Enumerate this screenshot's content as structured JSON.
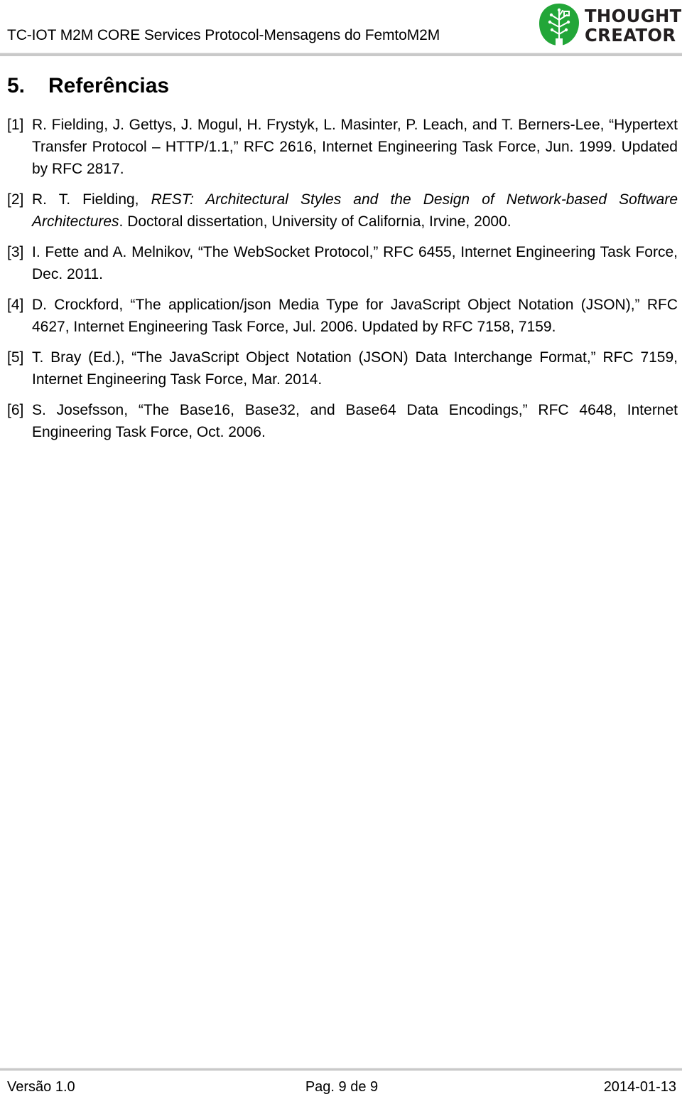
{
  "header": {
    "document_title": "TC-IOT M2M CORE Services Protocol-Mensagens do FemtoM2M",
    "logo": {
      "name": "thought-creator-logo",
      "line1": "THOUGHT",
      "line2": "CREATOR",
      "mark_color": "#22a638",
      "text_color": "#231f20"
    },
    "rule_color": "#c9c9c9"
  },
  "section": {
    "number": "5.",
    "title": "Referências"
  },
  "references": [
    {
      "marker": "[1]",
      "parts": [
        {
          "style": "normal",
          "text": "R. Fielding, J. Gettys, J. Mogul, H. Frystyk, L. Masinter, P. Leach, and T. Berners-Lee, “Hypertext Transfer Protocol – HTTP/1.1,” RFC 2616, Internet Engineering Task Force, Jun. 1999. Updated by RFC 2817."
        }
      ]
    },
    {
      "marker": "[2]",
      "parts": [
        {
          "style": "normal",
          "text": "R. T. Fielding, "
        },
        {
          "style": "italic",
          "text": "REST: Architectural Styles and the Design of Network-based Software Architectures"
        },
        {
          "style": "normal",
          "text": ". Doctoral dissertation, University of California, Irvine, 2000."
        }
      ]
    },
    {
      "marker": "[3]",
      "parts": [
        {
          "style": "normal",
          "text": "I. Fette and A. Melnikov, “The WebSocket Protocol,” RFC 6455, Internet Engineering Task Force, Dec. 2011."
        }
      ]
    },
    {
      "marker": "[4]",
      "parts": [
        {
          "style": "normal",
          "text": "D. Crockford, “The application/json Media Type for JavaScript Object Notation (JSON),” RFC 4627, Internet Engineering Task Force, Jul. 2006. Updated by RFC 7158, 7159."
        }
      ]
    },
    {
      "marker": "[5]",
      "parts": [
        {
          "style": "normal",
          "text": "T. Bray (Ed.), “The JavaScript Object Notation (JSON) Data Interchange Format,” RFC 7159, Internet Engineering Task Force, Mar. 2014."
        }
      ]
    },
    {
      "marker": "[6]",
      "parts": [
        {
          "style": "normal",
          "text": "S. Josefsson, “The Base16, Base32, and Base64 Data Encodings,” RFC 4648, Internet Engineering Task Force, Oct. 2006."
        }
      ]
    }
  ],
  "footer": {
    "version": "Versão 1.0",
    "page": "Pag. 9 de 9",
    "date": "2014-01-13",
    "rule_color": "#c9c9c9"
  }
}
